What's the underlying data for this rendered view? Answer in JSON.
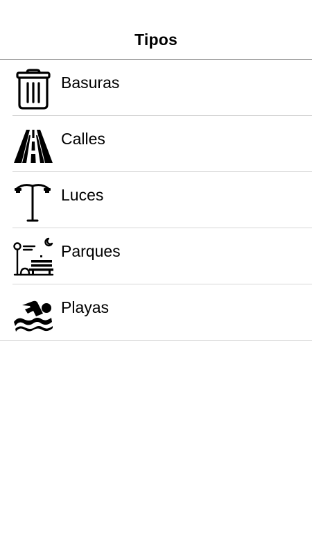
{
  "header": {
    "title": "Tipos"
  },
  "types": [
    {
      "label": "Basuras",
      "icon": "trash-can-icon"
    },
    {
      "label": "Calles",
      "icon": "road-icon"
    },
    {
      "label": "Luces",
      "icon": "street-lamp-icon"
    },
    {
      "label": "Parques",
      "icon": "park-bench-icon"
    },
    {
      "label": "Playas",
      "icon": "swimmer-icon"
    }
  ],
  "colors": {
    "background": "#ffffff",
    "text": "#000000",
    "divider": "#d6d6d6",
    "header_border": "#8a8a8a"
  }
}
